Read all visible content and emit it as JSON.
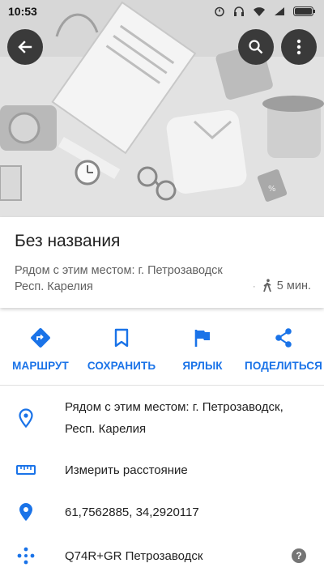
{
  "status_bar": {
    "time": "10:53"
  },
  "header": {
    "back_icon": "arrow-left-icon",
    "search_icon": "search-icon",
    "more_icon": "more-vert-icon"
  },
  "place": {
    "title": "Без названия",
    "nearby_line1": "Рядом с этим местом: г. Петрозаводск",
    "nearby_line2": "Респ. Карелия",
    "walk_time": "5 мин."
  },
  "actions": [
    {
      "label": "МАРШРУТ",
      "icon": "directions-icon"
    },
    {
      "label": "СОХРАНИТЬ",
      "icon": "bookmark-icon"
    },
    {
      "label": "ЯРЛЫК",
      "icon": "flag-icon"
    },
    {
      "label": "ПОДЕЛИТЬСЯ",
      "icon": "share-icon"
    }
  ],
  "details": {
    "address_line1": "Рядом с этим местом: г. Петрозаводск,",
    "address_line2": "Респ. Карелия",
    "measure_distance": "Измерить расстояние",
    "coordinates": "61,7562885, 34,2920117",
    "plus_code": "Q74R+GR Петрозаводск",
    "help_glyph": "?"
  },
  "colors": {
    "accent": "#1a73e8",
    "title": "#212121",
    "secondary": "#616161",
    "fab_bg": "#3a3a3a"
  }
}
